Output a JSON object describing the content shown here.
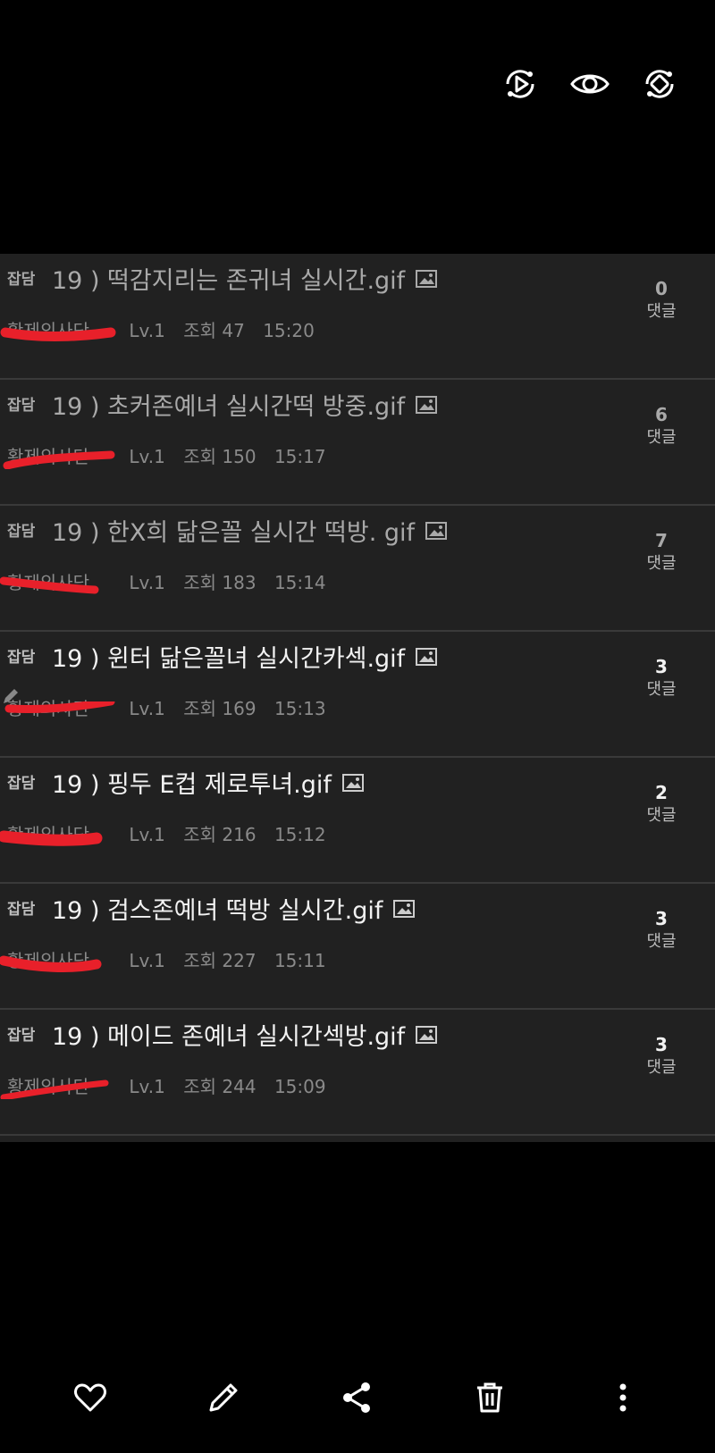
{
  "posts": [
    {
      "category": "잡담",
      "title": "19 ) 떡감지리는 존귀녀 실시간.gif",
      "author": "황제의사단",
      "level": "Lv.1",
      "views": "조회 47",
      "time": "15:20",
      "comment_count": "0",
      "comment_label": "댓글"
    },
    {
      "category": "잡담",
      "title": "19 ) 초커존예녀 실시간떡 방중.gif",
      "author": "황제의사단",
      "level": "Lv.1",
      "views": "조회 150",
      "time": "15:17",
      "comment_count": "6",
      "comment_label": "댓글"
    },
    {
      "category": "잡담",
      "title": "19 ) 한X희 닮은꼴 실시간 떡방. gif",
      "author": "황제의사단",
      "level": "Lv.1",
      "views": "조회 183",
      "time": "15:14",
      "comment_count": "7",
      "comment_label": "댓글"
    },
    {
      "category": "잡담",
      "title": "19 ) 윈터 닮은꼴녀 실시간카섹.gif",
      "author": "황제의사단",
      "level": "Lv.1",
      "views": "조회 169",
      "time": "15:13",
      "comment_count": "3",
      "comment_label": "댓글"
    },
    {
      "category": "잡담",
      "title": "19 ) 핑두 E컵 제로투녀.gif",
      "author": "황제의사단",
      "level": "Lv.1",
      "views": "조회 216",
      "time": "15:12",
      "comment_count": "2",
      "comment_label": "댓글"
    },
    {
      "category": "잡담",
      "title": "19 ) 검스존예녀 떡방 실시간.gif",
      "author": "황제의사단",
      "level": "Lv.1",
      "views": "조회 227",
      "time": "15:11",
      "comment_count": "3",
      "comment_label": "댓글"
    },
    {
      "category": "잡담",
      "title": "19 ) 메이드 존예녀 실시간섹방.gif",
      "author": "황제의사단",
      "level": "Lv.1",
      "views": "조회 244",
      "time": "15:09",
      "comment_count": "3",
      "comment_label": "댓글"
    }
  ],
  "icons": {
    "top": [
      "play-rotate-icon",
      "eye-icon",
      "auto-rotate-icon"
    ],
    "bottom": [
      "heart-icon",
      "edit-icon",
      "share-icon",
      "delete-icon",
      "more-icon"
    ]
  },
  "colors": {
    "background": "#000000",
    "list_bg": "#212121",
    "divider": "#3a3a3a",
    "redaction": "#e8202a"
  }
}
